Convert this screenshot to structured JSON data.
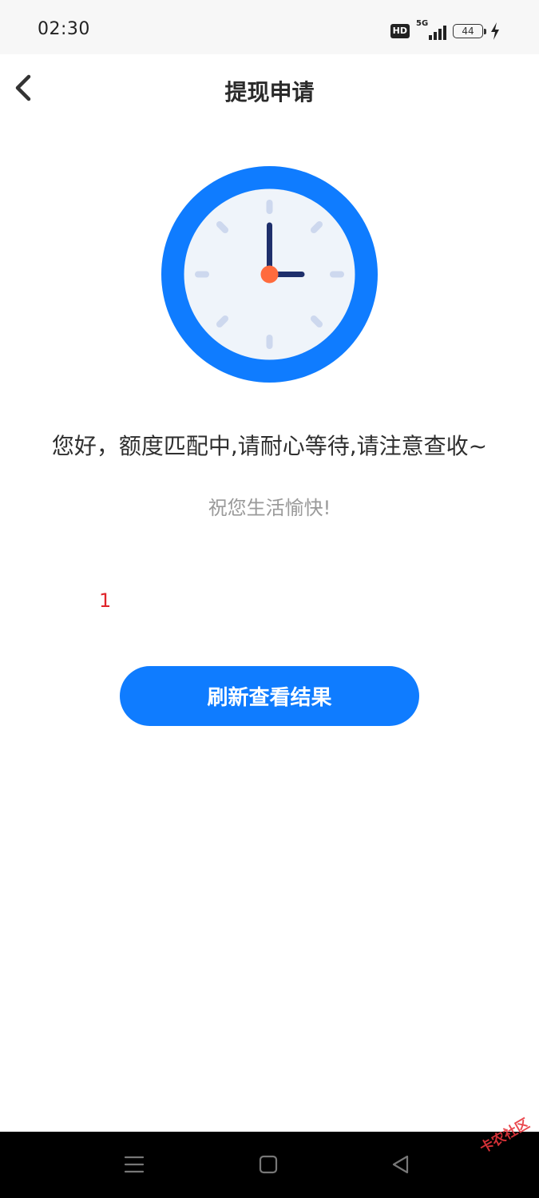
{
  "status_bar": {
    "time": "02:30",
    "hd_badge": "HD",
    "network": "5G",
    "battery": "44"
  },
  "nav": {
    "title": "提现申请",
    "back_icon": "chevron-left-icon"
  },
  "content": {
    "illustration_icon": "clock-icon",
    "main_message": "您好，额度匹配中,请耐心等待,请注意查收~",
    "sub_message": "祝您生活愉快!",
    "counter": "1"
  },
  "actions": {
    "refresh_label": "刷新查看结果"
  },
  "system_nav": {
    "icons": [
      "menu-icon",
      "home-icon",
      "back-triangle-icon"
    ]
  },
  "watermark": "卡农社区",
  "colors": {
    "primary": "#0F7CFF",
    "clock_face": "#EFF4FA",
    "clock_hands": "#1E2F6B",
    "clock_center": "#FF6B3D",
    "counter_red": "#E0242A"
  }
}
